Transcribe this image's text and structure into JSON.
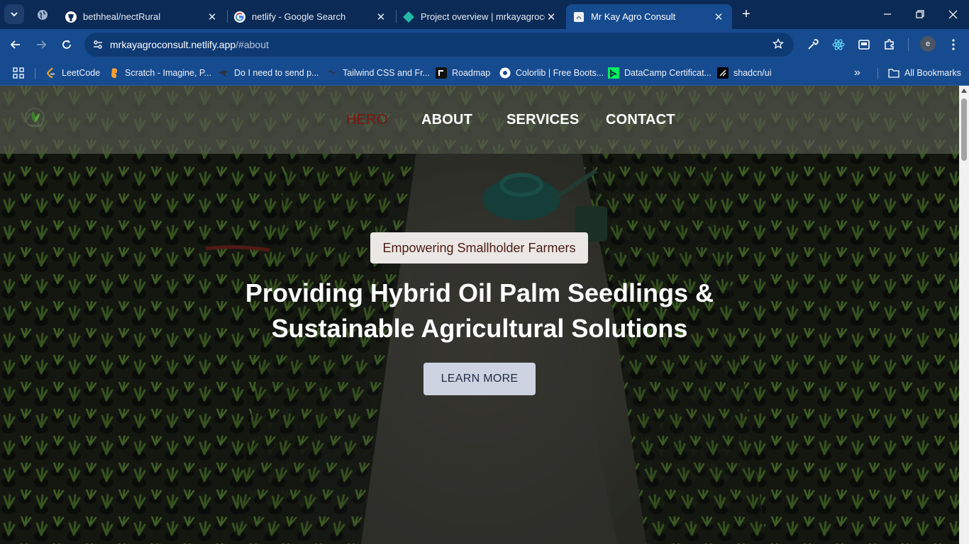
{
  "browser": {
    "tabs": [
      {
        "title": "bethheal/nectRural",
        "icon": "github-icon",
        "active": false
      },
      {
        "title": "netlify - Google Search",
        "icon": "google-icon",
        "active": false
      },
      {
        "title": "Project overview | mrkayagroconsult",
        "icon": "netlify-icon",
        "active": false
      },
      {
        "title": "Mr Kay Agro Consult",
        "icon": "page-icon",
        "active": true
      }
    ],
    "close_glyph": "✕",
    "new_tab_glyph": "+",
    "url_host": "mrkayagroconsult.netlify.app",
    "url_path": "/#about",
    "profile_initial": "e",
    "bookmarks": [
      {
        "label": "LeetCode",
        "icon": "leetcode-icon"
      },
      {
        "label": "Scratch - Imagine, P...",
        "icon": "scratch-icon"
      },
      {
        "label": "Do I need to send p...",
        "icon": "bird-icon"
      },
      {
        "label": "Tailwind CSS and Fr...",
        "icon": "tailwind-icon"
      },
      {
        "label": "Roadmap",
        "icon": "roadmap-icon"
      },
      {
        "label": "Colorlib | Free Boots...",
        "icon": "colorlib-icon"
      },
      {
        "label": "DataCamp Certificat...",
        "icon": "datacamp-icon"
      },
      {
        "label": "shadcn/ui",
        "icon": "shadcn-icon"
      }
    ],
    "all_bookmarks_label": "All Bookmarks",
    "overflow_glyph": "»"
  },
  "site": {
    "nav": [
      {
        "label": "HERO",
        "active": true
      },
      {
        "label": "ABOUT",
        "active": false
      },
      {
        "label": "SERVICES",
        "active": false
      },
      {
        "label": "CONTACT",
        "active": false
      }
    ],
    "hero": {
      "badge": "Empowering Smallholder Farmers",
      "headline_line1": "Providing Hybrid Oil Palm Seedlings &",
      "headline_line2": "Sustainable Agricultural Solutions",
      "cta": "LEARN MORE"
    }
  },
  "colors": {
    "tabstrip": "#0b2a55",
    "toolbar": "#174b8f",
    "nav_active": "#7a1410",
    "badge_bg": "#ebe7e4",
    "cta_bg": "#cdd3e0"
  }
}
